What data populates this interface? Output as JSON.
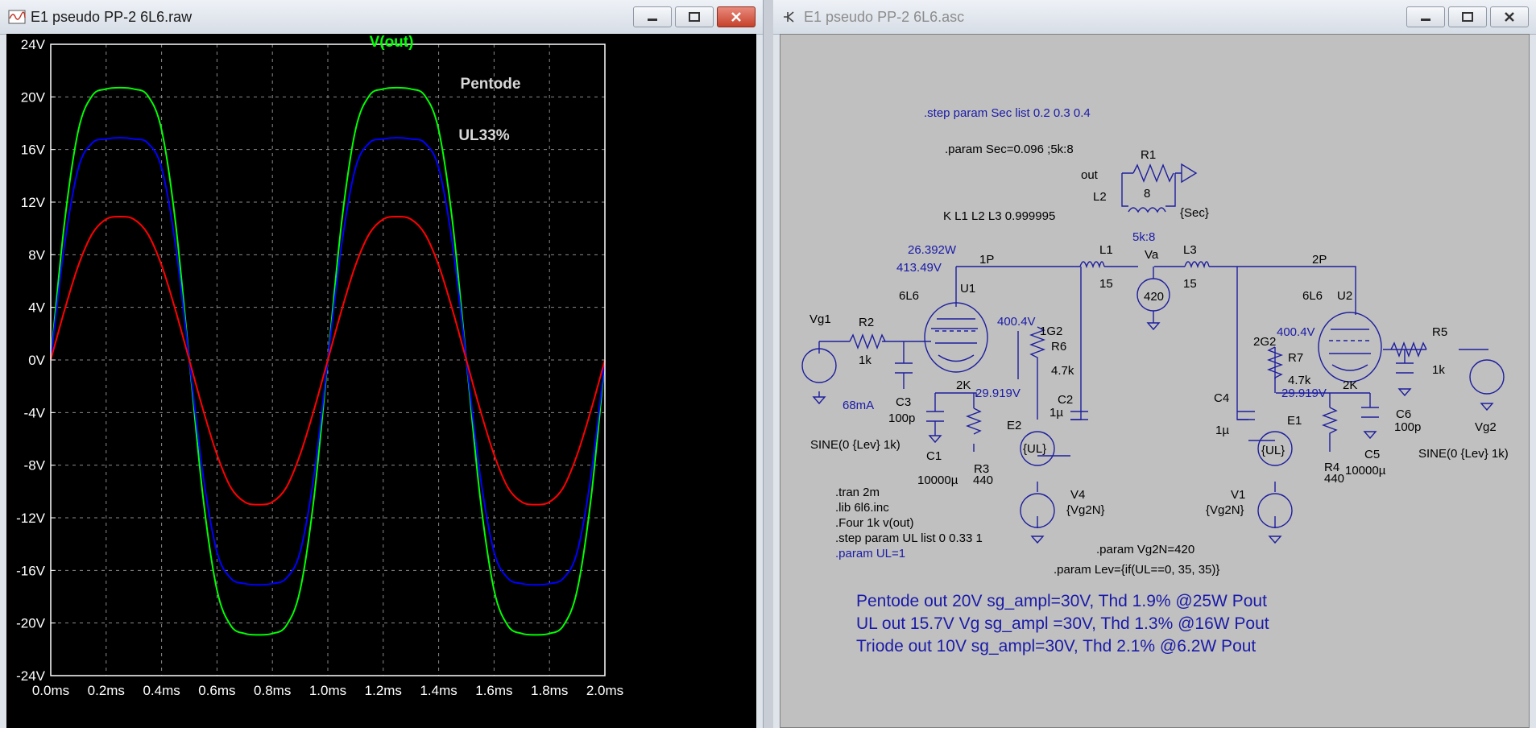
{
  "left_window": {
    "title": "E1 pseudo PP-2 6L6.raw",
    "icon": "waveform-icon",
    "trace_label": "V(out)",
    "annotations": {
      "top": "Pentode",
      "middle": "UL33%"
    },
    "colors": {
      "background": "#000000",
      "pentode": "#00ff00",
      "ul": "#0000ff",
      "triode": "#ff0000",
      "grid": "#808080",
      "axis_text": "#ffffff"
    }
  },
  "right_window": {
    "title": "E1 pseudo PP-2 6L6.asc",
    "icon": "schematic-icon",
    "colors": {
      "background": "#c0c0c0",
      "wire": "#1e1e9e",
      "directive": "#1a1aa8",
      "text": "#000000"
    },
    "directives": {
      "step_sec": ".step param Sec list 0.2 0.3 0.4",
      "param_sec": ".param Sec=0.096 ;5k:8",
      "k_coupling": "K L1 L2  L3 0.999995",
      "tran": ".tran 2m",
      "lib": ".lib 6l6.inc",
      "four": ".Four 1k v(out)",
      "step_ul": ".step param UL list 0 0.33 1",
      "param_ul": ".param UL=1",
      "param_vg2n": ".param Vg2N=420",
      "param_lev": ".param Lev={if(UL==0, 35, 35)}"
    },
    "operating_points": {
      "power": "26.392W",
      "v_1p": "413.49V",
      "v_g2_left": "400.4V",
      "v_k_left": "29.919V",
      "i_left": "68mA",
      "v_g2_right": "400.4V",
      "v_k_right": "29.919V"
    },
    "components": {
      "R1": "R1",
      "R1_val": "8",
      "out": "out",
      "L2": "L2",
      "L2_val": "{Sec}",
      "L2_ratio": "5k:8",
      "L1": "L1",
      "L1_val": "15",
      "Va": "Va",
      "Va_val": "420",
      "L3": "L3",
      "L3_val": "15",
      "net_1P": "1P",
      "net_2P": "2P",
      "tube_left": "6L6",
      "U1": "U1",
      "tube_right": "6L6",
      "U2": "U2",
      "Vg1": "Vg1",
      "R2": "R2",
      "R2_val": "1k",
      "C3": "C3",
      "C3_val": "100p",
      "net_1G2": "1G2",
      "R6": "R6",
      "R6_val": "4.7k",
      "twoK_left": "2K",
      "C2": "C2",
      "C2_val": "1µ",
      "E2": "E2",
      "E2_val": "{UL}",
      "C1": "C1",
      "C1_val": "10000µ",
      "R3": "R3",
      "R3_val": "440",
      "V4": "V4",
      "V4_val": "{Vg2N}",
      "sine_left": "SINE(0 {Lev} 1k)",
      "C4": "C4",
      "C4_val": "1µ",
      "net_2G2": "2G2",
      "R7": "R7",
      "R7_val": "4.7k",
      "twoK_right": "2K",
      "E1": "E1",
      "E1_val": "{UL}",
      "R4": "R4",
      "R4_val": "440",
      "C5": "C5",
      "C5_val": "10000µ",
      "V1": "V1",
      "V1_val": "{Vg2N}",
      "C6": "C6",
      "C6_val": "100p",
      "R5": "R5",
      "R5_val": "1k",
      "Vg2": "Vg2",
      "sine_right": "SINE(0 {Lev} 1k)"
    },
    "notes": [
      "Pentode out 20V sg_ampl=30V, Thd 1.9% @25W Pout",
      "UL out 15.7V Vg sg_ampl =30V, Thd 1.3% @16W Pout",
      "Triode out 10V sg_ampl=30V, Thd 2.1% @6.2W Pout"
    ]
  },
  "chart_data": {
    "type": "line",
    "title": "V(out)",
    "xlabel": "",
    "ylabel": "",
    "xlim": [
      0,
      2.0
    ],
    "ylim": [
      -24,
      24
    ],
    "x_ticks": [
      "0.0ms",
      "0.2ms",
      "0.4ms",
      "0.6ms",
      "0.8ms",
      "1.0ms",
      "1.2ms",
      "1.4ms",
      "1.6ms",
      "1.8ms",
      "2.0ms"
    ],
    "y_ticks": [
      "24V",
      "20V",
      "16V",
      "12V",
      "8V",
      "4V",
      "0V",
      "-4V",
      "-8V",
      "-12V",
      "-16V",
      "-20V",
      "-24V"
    ],
    "grid": true,
    "x": [
      0,
      0.05,
      0.1,
      0.15,
      0.2,
      0.25,
      0.3,
      0.35,
      0.4,
      0.45,
      0.5,
      0.55,
      0.6,
      0.65,
      0.7,
      0.75,
      0.8,
      0.85,
      0.9,
      0.95,
      1.0,
      1.05,
      1.1,
      1.15,
      1.2,
      1.25,
      1.3,
      1.35,
      1.4,
      1.45,
      1.5,
      1.55,
      1.6,
      1.65,
      1.7,
      1.75,
      1.8,
      1.85,
      1.9,
      1.95,
      2.0
    ],
    "series": [
      {
        "name": "Pentode",
        "color": "#00ff00",
        "values": [
          0,
          10.5,
          17.5,
          20.1,
          20.6,
          20.7,
          20.6,
          20.1,
          17.5,
          10.5,
          0,
          -10.5,
          -17.5,
          -20.2,
          -20.8,
          -20.9,
          -20.8,
          -20.2,
          -17.5,
          -10.5,
          0,
          10.5,
          17.5,
          20.1,
          20.6,
          20.7,
          20.6,
          20.1,
          17.5,
          10.5,
          0,
          -10.5,
          -17.5,
          -20.2,
          -20.8,
          -20.9,
          -20.8,
          -20.2,
          -17.5,
          -10.5,
          0
        ]
      },
      {
        "name": "UL33%",
        "color": "#0000ff",
        "values": [
          0,
          8.8,
          14.6,
          16.5,
          16.8,
          16.9,
          16.8,
          16.5,
          14.6,
          8.8,
          0,
          -8.8,
          -14.6,
          -16.6,
          -17.0,
          -17.1,
          -17.0,
          -16.6,
          -14.6,
          -8.8,
          0,
          8.8,
          14.6,
          16.5,
          16.8,
          16.9,
          16.8,
          16.5,
          14.6,
          8.8,
          0,
          -8.8,
          -14.6,
          -16.6,
          -17.0,
          -17.1,
          -17.0,
          -16.6,
          -14.6,
          -8.8,
          0
        ]
      },
      {
        "name": "",
        "color": "#ff0000",
        "values": [
          0,
          3.8,
          7.2,
          9.6,
          10.7,
          10.9,
          10.7,
          9.6,
          7.2,
          3.8,
          0,
          -3.8,
          -7.2,
          -9.7,
          -10.8,
          -11.0,
          -10.8,
          -9.7,
          -7.2,
          -3.8,
          0,
          3.8,
          7.2,
          9.6,
          10.7,
          10.9,
          10.7,
          9.6,
          7.2,
          3.8,
          0,
          -3.8,
          -7.2,
          -9.7,
          -10.8,
          -11.0,
          -10.8,
          -9.7,
          -7.2,
          -3.8,
          0
        ]
      }
    ]
  }
}
